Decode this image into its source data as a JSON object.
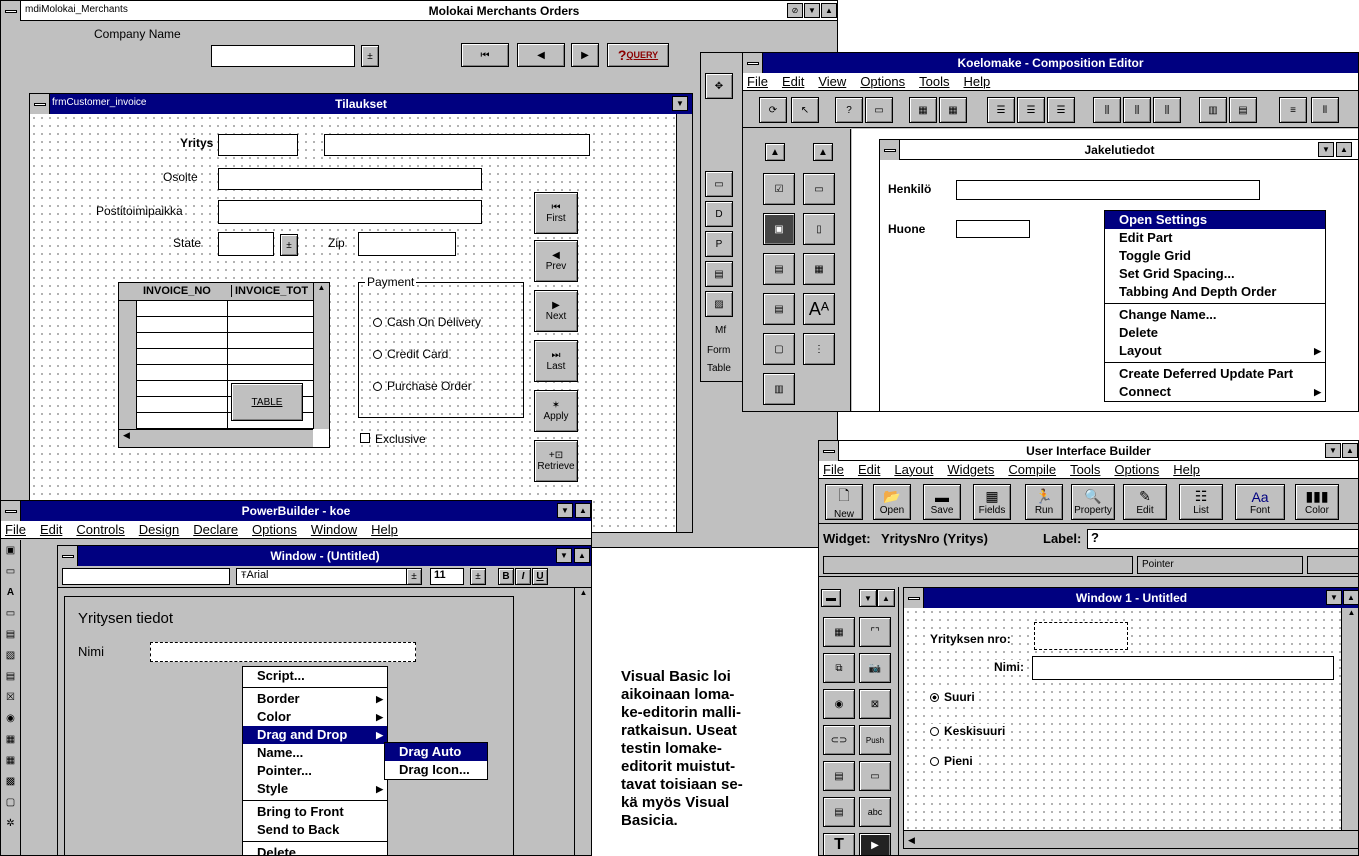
{
  "molokai": {
    "title": "Molokai Merchants Orders",
    "mdi_name": "mdiMolokai_Merchants",
    "company_label": "Company Name",
    "query": "QUERY"
  },
  "customer": {
    "name": "frmCustomer_invoice",
    "title": "Tilaukset",
    "labels": {
      "company": "Yritys",
      "address": "Osoite",
      "postal": "Postitoimipaikka",
      "state": "State",
      "zip": "Zip"
    },
    "columns": [
      "INVOICE_NO",
      "INVOICE_TOT"
    ],
    "table_button": "TABLE",
    "payment": {
      "legend": "Payment",
      "options": [
        "Cash On Delivery",
        "Credit Card",
        "Purchase Order"
      ]
    },
    "exclusive": "Exclusive",
    "nav": [
      "First",
      "Prev",
      "Next",
      "Last",
      "Apply",
      "Retrieve"
    ]
  },
  "koelomake": {
    "title": "Koelomake - Composition Editor",
    "menu": [
      "File",
      "Edit",
      "View",
      "Options",
      "Tools",
      "Help"
    ],
    "inner_title": "Jakelutiedot",
    "labels": {
      "person": "Henkilö",
      "room": "Huone"
    },
    "side_items": [
      "Mf",
      "Form",
      "Table"
    ],
    "context": [
      "Open Settings",
      "Edit Part",
      "Toggle Grid",
      "Set Grid Spacing...",
      "Tabbing And Depth Order",
      "Change Name...",
      "Delete",
      "Layout",
      "Create Deferred Update Part",
      "Connect"
    ]
  },
  "powerbuilder": {
    "title": "PowerBuilder - koe",
    "menu": [
      "File",
      "Edit",
      "Controls",
      "Design",
      "Declare",
      "Options",
      "Window",
      "Help"
    ],
    "inner_title": "Window - (Untitled)",
    "font": "Arial",
    "size": "11",
    "style_buttons": [
      "B",
      "I",
      "U"
    ],
    "group_title": "Yritysen tiedot",
    "name_label": "Nimi",
    "context": [
      "Script...",
      "Border",
      "Color",
      "Drag and Drop",
      "Name...",
      "Pointer...",
      "Style",
      "Bring to Front",
      "Send to Back",
      "Delete"
    ],
    "submenu": [
      "Drag Auto",
      "Drag Icon..."
    ]
  },
  "caption": [
    "Visual Basic loi",
    "aikoinaan loma-",
    "ke-editorin malli-",
    "ratkaisun. Useat",
    "testin lomake-",
    "editorit muistut-",
    "tavat toisiaan se-",
    "kä myös Visual",
    "Basicia."
  ],
  "uib": {
    "title": "User Interface Builder",
    "menu": [
      "File",
      "Edit",
      "Layout",
      "Widgets",
      "Compile",
      "Tools",
      "Options",
      "Help"
    ],
    "toolbar": [
      "New",
      "Open",
      "Save",
      "Fields",
      "Run",
      "Property",
      "Edit",
      "List",
      "Font",
      "Color"
    ],
    "widget_label": "Widget:",
    "widget_value": "YritysNro (Yritys)",
    "label_label": "Label:",
    "label_value": "?",
    "status": "Pointer",
    "inner_title": "Window 1 - Untitled",
    "field1": "Yrityksen nro:",
    "field2": "Nimi:",
    "options": [
      "Suuri",
      "Keskisuuri",
      "Pieni"
    ],
    "tool_push": "Push",
    "tool_abc": "abc"
  }
}
